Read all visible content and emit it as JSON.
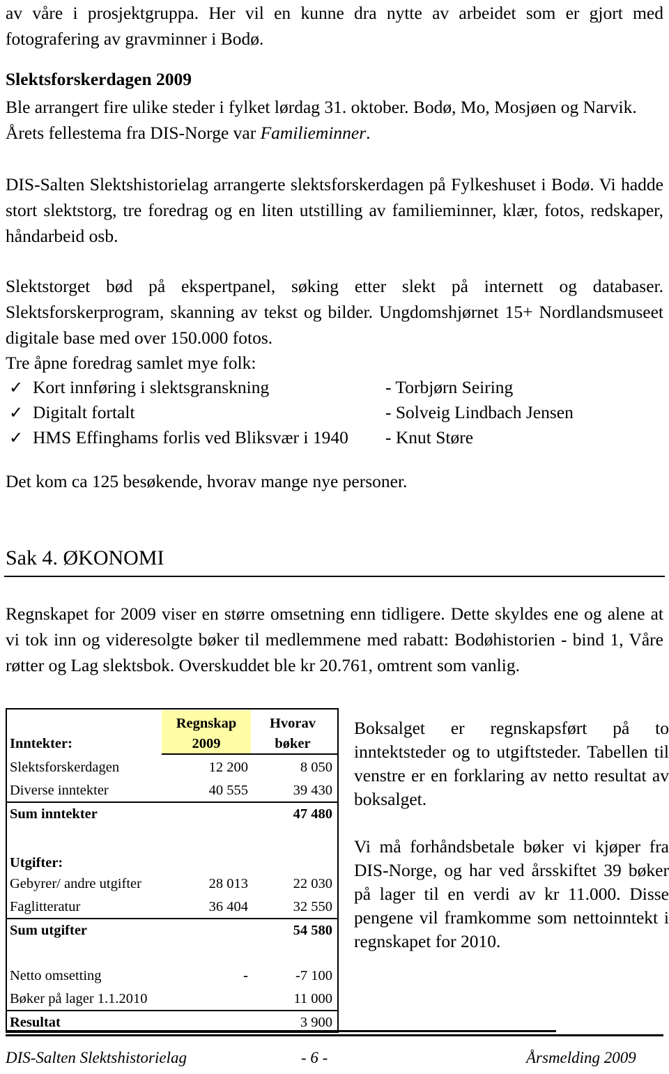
{
  "document": {
    "intro_paragraph": "av våre i prosjektgruppa. Her vil en kunne dra nytte av arbeidet som er gjort med fotografering av gravminner i Bodø.",
    "section_slektsforskerdagen": {
      "heading": "Slektsforskerdagen 2009",
      "para1_pre": "Ble arrangert fire ulike steder i fylket lørdag 31. oktober. Bodø, Mo, Mosjøen og Narvik. Årets fellestema fra DIS-Norge var ",
      "para1_italic": "Familieminner",
      "para1_post": ".",
      "para2": "DIS-Salten Slektshistorielag arrangerte slektsforskerdagen på Fylkeshuset i Bodø. Vi hadde stort slektstorg, tre foredrag og en liten utstilling av familieminner, klær, fotos, redskaper, håndarbeid osb.",
      "para3": "Slektstorget bød på ekspertpanel, søking etter slekt på internett og databaser. Slektsforskerprogram, skanning av tekst og bilder. Ungdomshjørnet 15+ Nordlandsmuseet digitale base med over 150.000 fotos.",
      "lecture_intro": "Tre åpne foredrag samlet mye folk:",
      "lectures": [
        {
          "bullet": "✓",
          "title": "Kort innføring i slektsgranskning",
          "speaker": "- Torbjørn Seiring"
        },
        {
          "bullet": "✓",
          "title": "Digitalt fortalt",
          "speaker": "- Solveig Lindbach Jensen"
        },
        {
          "bullet": "✓",
          "title": "HMS Effinghams forlis ved Bliksvær i 1940",
          "speaker": "- Knut Støre"
        }
      ],
      "visitors": "Det kom ca 125 besøkende, hvorav mange nye personer."
    },
    "section_okonomi": {
      "heading": "Sak 4. ØKONOMI",
      "para1": "Regnskapet for 2009 viser en større omsetning enn tidligere. Dette skyldes ene og alene at vi tok inn og videresolgte bøker til medlemmene med rabatt: Bodøhistorien - bind 1, Våre røtter og Lag slektsbok. Overskuddet ble kr 20.761, omtrent som vanlig.",
      "side_para1": "Boksalget er regnskapsført på to inntektsteder og to utgiftsteder. Tabellen til venstre er en forklaring av netto resultat av boksalget.",
      "side_para2": "Vi må forhåndsbetale bøker vi kjøper fra DIS-Norge, og har ved årsskiftet 39 bøker på lager til en verdi av kr 11.000. Disse pengene vil framkomme som nettoinntekt i regnskapet for 2010."
    },
    "finance_table": {
      "headers": {
        "label": "",
        "col2_line1": "Regnskap",
        "col2_line2": "2009",
        "col3_line1": "Hvorav",
        "col3_line2": "bøker"
      },
      "highlight_color": "#fffda6",
      "income_label": "Inntekter:",
      "income_rows": [
        {
          "label": "Slektsforskerdagen",
          "regnskap": "12 200",
          "boker": "8 050"
        },
        {
          "label": "Diverse inntekter",
          "regnskap": "40 555",
          "boker": "39 430"
        }
      ],
      "income_sum": {
        "label": "Sum inntekter",
        "regnskap": "",
        "boker": "47 480"
      },
      "expense_label": "Utgifter:",
      "expense_rows": [
        {
          "label": "Gebyrer/ andre utgifter",
          "regnskap": "28 013",
          "boker": "22 030"
        },
        {
          "label": "Faglitteratur",
          "regnskap": "36 404",
          "boker": "32 550"
        }
      ],
      "expense_sum": {
        "label": "Sum utgifter",
        "regnskap": "",
        "boker": "54 580"
      },
      "net_rows": [
        {
          "label": "Netto omsetting",
          "regnskap": "-",
          "boker": "-7 100"
        },
        {
          "label": "Bøker på lager 1.1.2010",
          "regnskap": "",
          "boker": "11 000"
        }
      ],
      "result": {
        "label": "Resultat",
        "regnskap": "",
        "boker": "3 900"
      }
    },
    "footer": {
      "left": "DIS-Salten Slektshistorielag",
      "center": "- 6 -",
      "right": "Årsmelding 2009"
    }
  }
}
